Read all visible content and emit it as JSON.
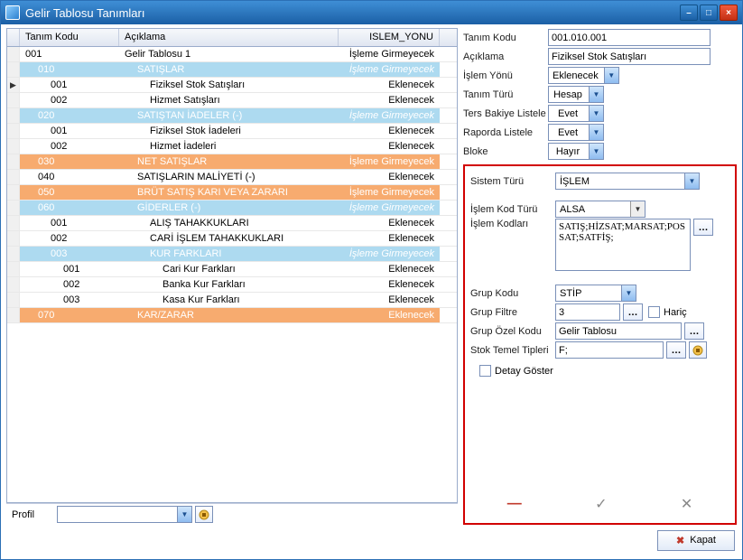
{
  "window": {
    "title": "Gelir Tablosu Tanımları",
    "min": "–",
    "max": "□",
    "close": "×"
  },
  "grid": {
    "headers": {
      "kod": "Tanım Kodu",
      "aciklama": "Açıklama",
      "islem": "ISLEM_YONU"
    },
    "rows": [
      {
        "style": "normal",
        "kod": "001",
        "aciklama": "Gelir Tablosu 1",
        "islem": "İşleme Girmeyecek"
      },
      {
        "style": "blue",
        "kod": "010",
        "aciklama": "SATIŞLAR",
        "islem": "İşleme Girmeyecek"
      },
      {
        "style": "normal",
        "kod": "001",
        "aciklama": "Fiziksel Stok Satışları",
        "islem": "Eklenecek",
        "marker": "▶"
      },
      {
        "style": "normal",
        "kod": "002",
        "aciklama": "Hizmet Satışları",
        "islem": "Eklenecek"
      },
      {
        "style": "blue",
        "kod": "020",
        "aciklama": "SATIŞTAN İADELER (-)",
        "islem": "İşleme Girmeyecek"
      },
      {
        "style": "normal",
        "kod": "001",
        "aciklama": "Fiziksel Stok İadeleri",
        "islem": "Eklenecek"
      },
      {
        "style": "normal",
        "kod": "002",
        "aciklama": "Hizmet İadeleri",
        "islem": "Eklenecek"
      },
      {
        "style": "orange",
        "kod": "030",
        "aciklama": "NET SATIŞLAR",
        "islem": "İşleme Girmeyecek"
      },
      {
        "style": "normal",
        "kod": "040",
        "aciklama": "SATIŞLARIN MALİYETİ (-)",
        "islem": "Eklenecek"
      },
      {
        "style": "orange",
        "kod": "050",
        "aciklama": "BRÜT SATIŞ KARI VEYA ZARARI",
        "islem": "İşleme Girmeyecek"
      },
      {
        "style": "blue",
        "kod": "060",
        "aciklama": "GİDERLER (-)",
        "islem": "İşleme Girmeyecek"
      },
      {
        "style": "normal",
        "kod": "001",
        "aciklama": "ALIŞ TAHAKKUKLARI",
        "islem": "Eklenecek"
      },
      {
        "style": "normal",
        "kod": "002",
        "aciklama": "CARİ İŞLEM TAHAKKUKLARI",
        "islem": "Eklenecek"
      },
      {
        "style": "blue",
        "kod": "003",
        "aciklama": "KUR FARKLARI",
        "islem": "İşleme Girmeyecek"
      },
      {
        "style": "normal",
        "kod": "001",
        "aciklama": "Cari Kur Farkları",
        "islem": "Eklenecek"
      },
      {
        "style": "normal",
        "kod": "002",
        "aciklama": "Banka Kur Farkları",
        "islem": "Eklenecek"
      },
      {
        "style": "normal",
        "kod": "003",
        "aciklama": "Kasa Kur Farkları",
        "islem": "Eklenecek"
      },
      {
        "style": "orange",
        "kod": "070",
        "aciklama": "KAR/ZARAR",
        "islem": "Eklenecek"
      }
    ],
    "indents": [
      0,
      1,
      2,
      2,
      1,
      2,
      2,
      1,
      1,
      1,
      1,
      2,
      2,
      2,
      3,
      3,
      3,
      1
    ]
  },
  "form": {
    "labels": {
      "tanim_kodu": "Tanım Kodu",
      "aciklama": "Açıklama",
      "islem_yonu": "İşlem Yönü",
      "tanim_turu": "Tanım Türü",
      "ters_bakiye": "Ters Bakiye Listele",
      "raporda": "Raporda Listele",
      "bloke": "Bloke",
      "sistem_turu": "Sistem Türü",
      "islem_kod_turu": "İşlem Kod Türü",
      "islem_kodlari": "İşlem Kodları",
      "grup_kodu": "Grup Kodu",
      "grup_filtre": "Grup Filtre",
      "haric": "Hariç",
      "grup_ozel": "Grup Özel Kodu",
      "stok_temel": "Stok Temel Tipleri",
      "detay": "Detay Göster"
    },
    "values": {
      "tanim_kodu": "001.010.001",
      "aciklama": "Fiziksel Stok Satışları",
      "islem_yonu": "Eklenecek",
      "tanim_turu": "Hesap",
      "ters_bakiye": "Evet",
      "raporda": "Evet",
      "bloke": "Hayır",
      "sistem_turu": "İŞLEM",
      "islem_kod_turu": "ALSA",
      "islem_kodlari": "SATIŞ;HİZSAT;MARSAT;POSSAT;SATFİŞ;",
      "grup_kodu": "STİP",
      "grup_filtre": "3",
      "grup_ozel": "Gelir Tablosu",
      "stok_temel": "F;"
    }
  },
  "bottom": {
    "profil": "Profil"
  },
  "footer": {
    "kapat": "Kapat"
  }
}
